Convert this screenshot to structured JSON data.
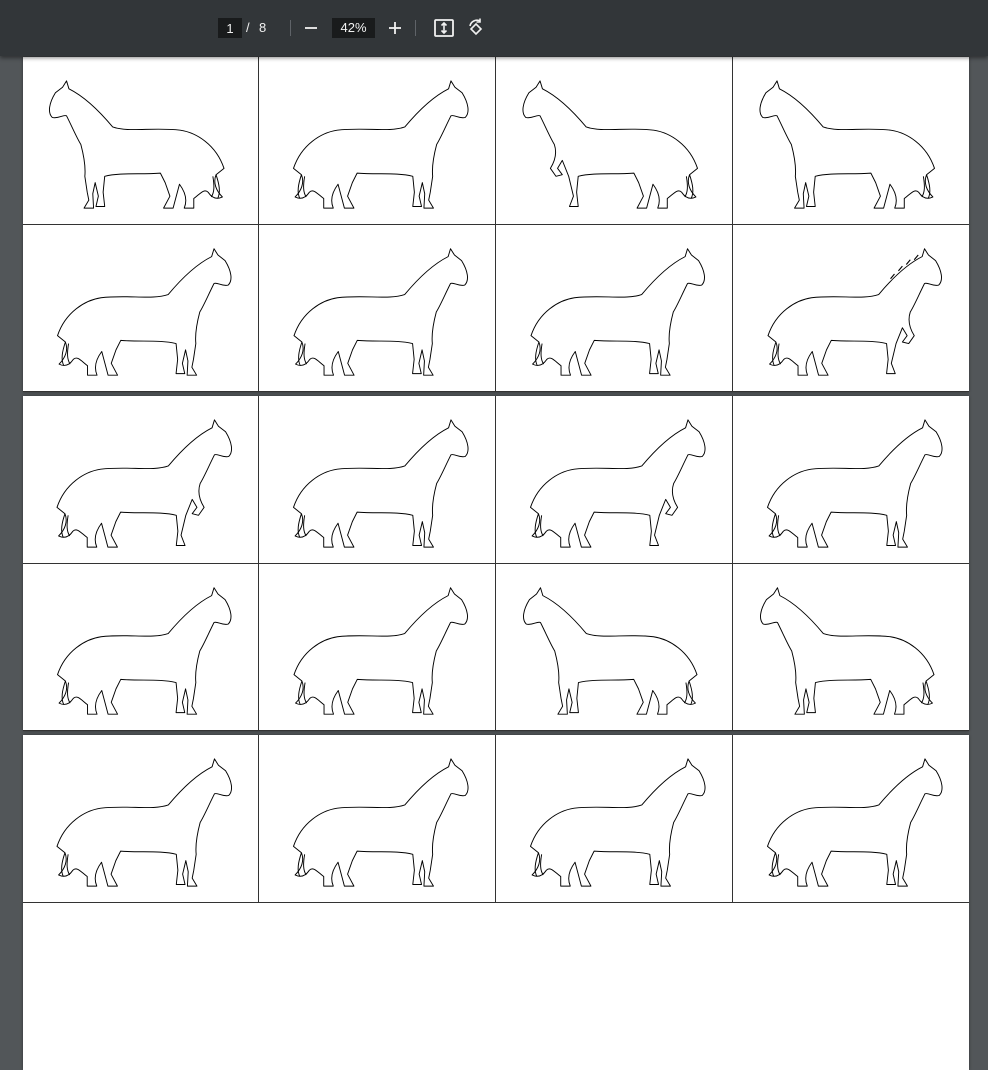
{
  "toolbar": {
    "page_current": "1",
    "page_separator": "/",
    "page_total": "8",
    "zoom_level": "42%",
    "zoom_out_icon": "minus-icon",
    "zoom_in_icon": "plus-icon",
    "fit_icon": "fit-to-page-icon",
    "rotate_icon": "rotate-icon"
  },
  "document": {
    "pages": [
      {
        "cells": [
          "horse-facing-left",
          "horse-facing-right",
          "horse-facing-left-lifted-leg",
          "horse-facing-left",
          "horse-facing-right",
          "horse-facing-right",
          "horse-facing-right",
          "horse-facing-right-galloping"
        ]
      },
      {
        "cells": [
          "horse-facing-right-lifted-leg",
          "horse-facing-right",
          "horse-facing-right-lifted-leg",
          "horse-facing-right",
          "horse-facing-right",
          "horse-facing-right",
          "horse-facing-left",
          "horse-facing-left"
        ]
      },
      {
        "cells": [
          "horse-partial",
          "horse-partial",
          "horse-partial",
          "horse-partial"
        ]
      }
    ]
  },
  "colors": {
    "viewer_background": "#525659",
    "toolbar_background": "#323639",
    "page_background": "#ffffff",
    "outline": "#000000"
  }
}
